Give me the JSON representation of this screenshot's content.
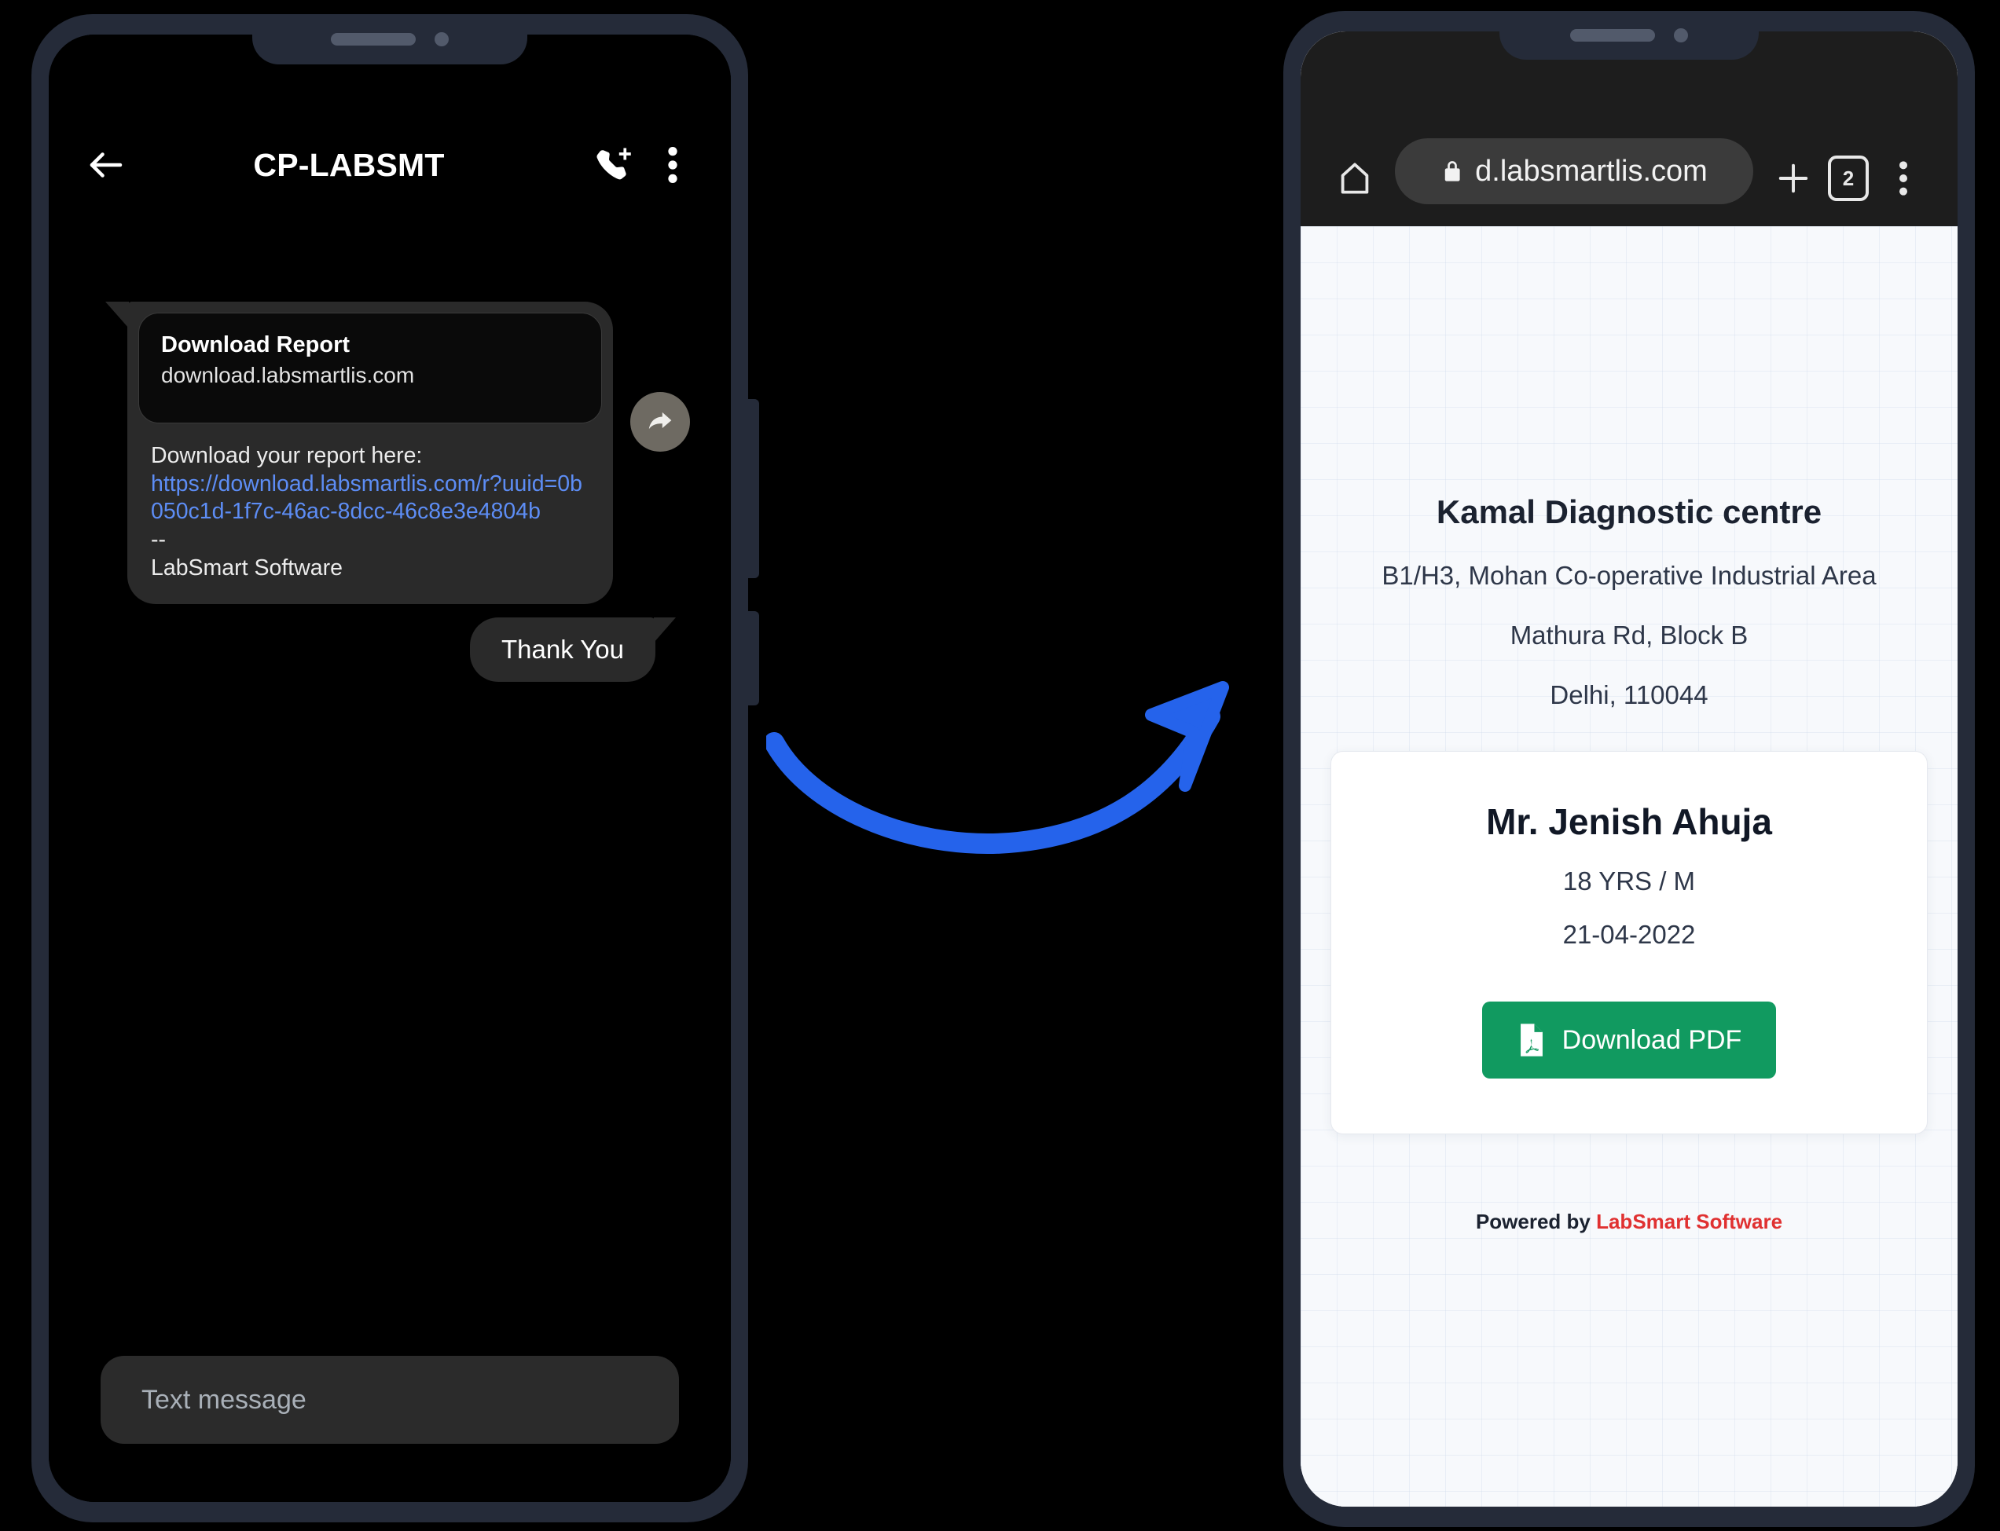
{
  "colors": {
    "phone_frame": "#252b39",
    "arrow": "#2563eb",
    "pdf_button": "#119a60",
    "brand_red": "#e03131",
    "link_blue": "#5d8df5"
  },
  "sms_phone": {
    "header": {
      "back_icon": "back-arrow-icon",
      "title": "CP-LABSMT",
      "call_add_icon": "phone-add-icon",
      "overflow_icon": "more-vertical-icon"
    },
    "incoming_message": {
      "link_preview": {
        "title": "Download Report",
        "host": "download.labsmartlis.com"
      },
      "body_intro": "Download your report here:",
      "body_link": "https://download.labsmartlis.com/r?uuid=0b050c1d-1f7c-46ac-8dcc-46c8e3e4804b",
      "body_dashes": "--",
      "body_signature": "LabSmart Software",
      "forward_icon": "forward-arrow-icon"
    },
    "outgoing_message": {
      "text": "Thank You"
    },
    "composer": {
      "placeholder": "Text message",
      "value": ""
    }
  },
  "browser_phone": {
    "toolbar": {
      "home_icon": "home-icon",
      "lock_icon": "lock-icon",
      "url": "d.labsmartlis.com",
      "new_tab_icon": "plus-icon",
      "tab_count": "2",
      "overflow_icon": "more-vertical-icon"
    },
    "report": {
      "lab_name": "Kamal Diagnostic centre",
      "address_lines": [
        "B1/H3, Mohan Co-operative Industrial Area",
        "Mathura Rd, Block B",
        "Delhi, 110044"
      ],
      "patient": {
        "name": "Mr. Jenish Ahuja",
        "age_sex": "18 YRS / M",
        "date": "21-04-2022"
      },
      "download_button": {
        "label": "Download PDF",
        "icon": "pdf-file-icon"
      },
      "footer": {
        "prefix": "Powered by ",
        "brand": "LabSmart Software"
      }
    }
  },
  "annotation": {
    "arrow_icon": "curved-arrow-icon"
  }
}
